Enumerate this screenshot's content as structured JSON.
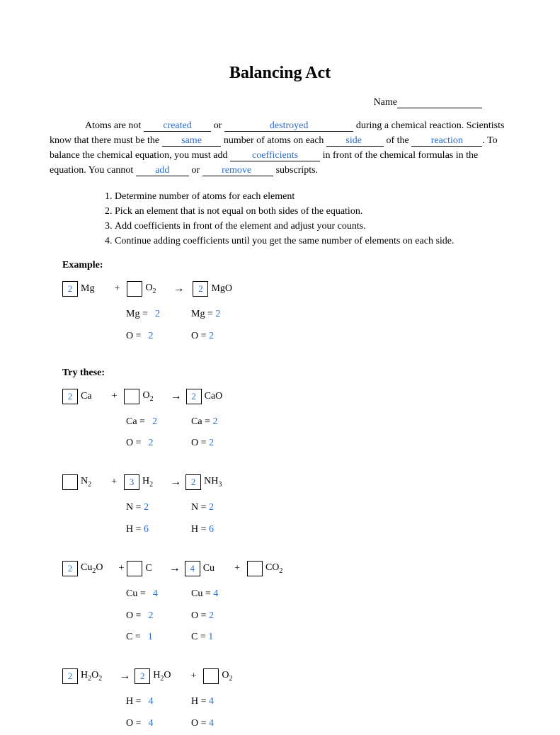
{
  "title": "Balancing Act",
  "nameLabel": "Name",
  "intro": {
    "t1": "Atoms are not ",
    "f1": "created",
    "t2": " or ",
    "f2": "destroyed",
    "t3": " during a chemical reaction. Scientists know that there must be the ",
    "f3": "same",
    "t4": " number of atoms on each ",
    "f4": "side",
    "t5": " of the ",
    "f5": "reaction",
    "t6": ". To balance the chemical equation, you must add ",
    "f6": "coefficients",
    "t7": " in front of the chemical formulas in the equation. You cannot ",
    "f7": "add",
    "t8": " or ",
    "f8": "remove",
    "t9": " subscripts."
  },
  "steps": [
    "Determine number of atoms for each element",
    "Pick an element that is not equal on both sides of the equation.",
    "Add coefficients in front of the element and adjust your counts.",
    "Continue adding coefficients until you get the same number of elements on each side."
  ],
  "exampleLabel": "Example:",
  "tryLabel": "Try these:",
  "arrow": "→",
  "plus": "+",
  "eq1": {
    "c1": "2",
    "f1": "Mg",
    "c2": "",
    "f2a": "O",
    "f2b": "2",
    "c3": "2",
    "f3": "MgO",
    "leftCounts": [
      [
        "Mg =",
        "2"
      ],
      [
        "O =",
        "2"
      ]
    ],
    "rightCounts": [
      [
        "Mg = ",
        "2"
      ],
      [
        "O = ",
        "2"
      ]
    ]
  },
  "eq2": {
    "c1": "2",
    "f1": "Ca",
    "c2": "",
    "f2a": "O",
    "f2b": "2",
    "c3": "2",
    "f3": "CaO",
    "leftCounts": [
      [
        "Ca =",
        "2"
      ],
      [
        "O =",
        "2"
      ]
    ],
    "rightCounts": [
      [
        "Ca = ",
        "2"
      ],
      [
        "O = ",
        "2"
      ]
    ]
  },
  "eq3": {
    "c1": "",
    "f1a": "N",
    "f1b": "2",
    "c2": "3",
    "f2a": "H",
    "f2b": "2",
    "c3": "2",
    "f3a": "NH",
    "f3b": "3",
    "leftCounts": [
      [
        "N = ",
        "2"
      ],
      [
        "H = ",
        "6"
      ]
    ],
    "rightCounts": [
      [
        "N = ",
        "2"
      ],
      [
        "H = ",
        "6"
      ]
    ]
  },
  "eq4": {
    "c1": "2",
    "f1a": "Cu",
    "f1b": "2",
    "f1c": "O",
    "c2": "",
    "f2": "C",
    "c3": "4",
    "f3": "Cu",
    "c4": "",
    "f4a": "CO",
    "f4b": "2",
    "leftCounts": [
      [
        "Cu =",
        "4"
      ],
      [
        "O =",
        "2"
      ],
      [
        "C =",
        "1"
      ]
    ],
    "rightCounts": [
      [
        "Cu = ",
        "4"
      ],
      [
        "O = ",
        "2"
      ],
      [
        "C = ",
        "1"
      ]
    ]
  },
  "eq5": {
    "c1": "2",
    "f1a": "H",
    "f1b": "2",
    "f1c": "O",
    "f1d": "2",
    "c2": "2",
    "f2a": "H",
    "f2b": "2",
    "f2c": "O",
    "c3": "",
    "f3a": "O",
    "f3b": "2",
    "leftCounts": [
      [
        "H =",
        "4"
      ],
      [
        "O =",
        "4"
      ]
    ],
    "rightCounts": [
      [
        "H = ",
        "4"
      ],
      [
        "O = ",
        "4"
      ]
    ]
  }
}
